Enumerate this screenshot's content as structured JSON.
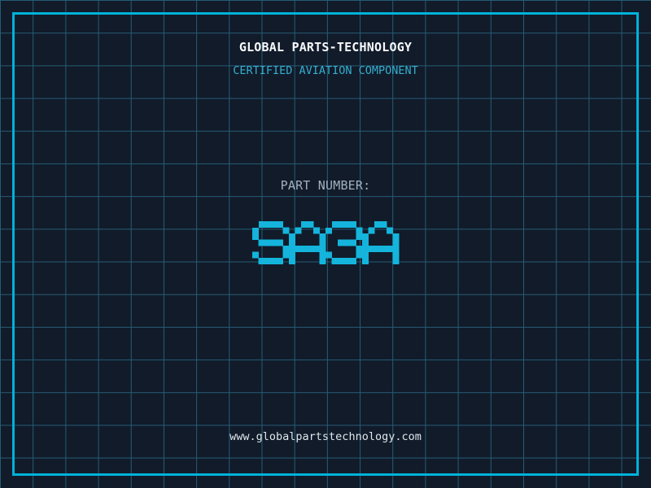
{
  "theme": {
    "background": "#111b2a",
    "grid_line": "#265c74",
    "frame": "#00b2da",
    "accent": "#14b4dc",
    "title_color": "#f7f9fa",
    "tagline_color": "#35aecf",
    "label_color": "#a3b0bd",
    "url_color": "#dde7eb"
  },
  "header": {
    "company": "GLOBAL PARTS-TECHNOLOGY",
    "tagline": "CERTIFIED AVIATION COMPONENT"
  },
  "part": {
    "label": "PART NUMBER:",
    "number": "SA3A"
  },
  "footer": {
    "website": "www.globalpartstechnology.com"
  }
}
